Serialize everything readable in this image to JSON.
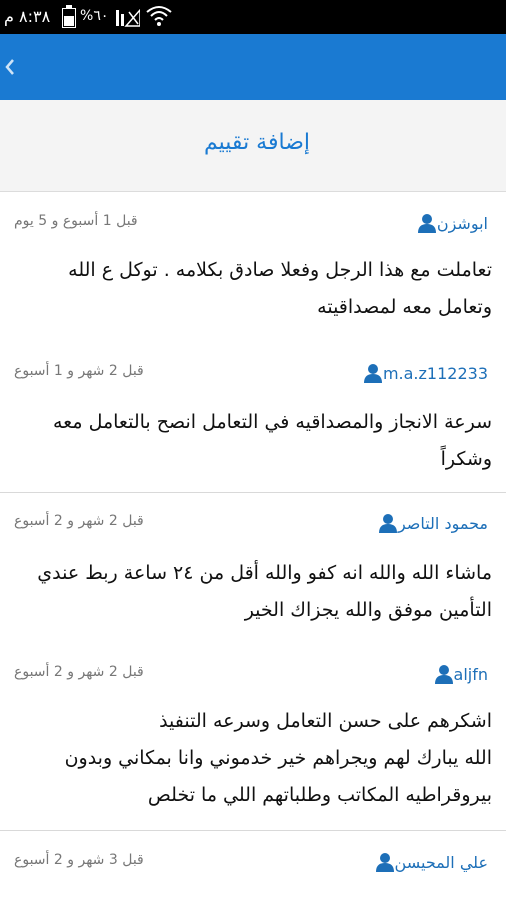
{
  "status_bar": {
    "time": "٨:٣٨ م",
    "battery": "%٦٠"
  },
  "app_bar": {
    "back_icon": "chevron-left-icon",
    "color": "#1a7ad2"
  },
  "header": {
    "add_rating": "إضافة تقييم"
  },
  "reviews": [
    {
      "user": "ابوشزن",
      "time": "قبل 1 أسبوع و 5 يوم",
      "lines": [
        "تعاملت مع هذا الرجل وفعلا صادق بكلامه . توكل ع الله",
        "وتعامل معه لمصداقيته"
      ]
    },
    {
      "user": "m.a.z112233",
      "time": "قبل 2 شهر و 1 أسبوع",
      "lines": [
        "سرعة الانجاز والمصداقيه في التعامل انصح بالتعامل معه",
        "وشكراً"
      ]
    },
    {
      "user": "محمود التاصر",
      "time": "قبل 2 شهر و 2 أسبوع",
      "lines": [
        "ماشاء الله والله انه كفو والله أقل من ٢٤ ساعة ربط عندي",
        "التأمين موفق والله يجزاك الخير"
      ]
    },
    {
      "user": "aljfn",
      "time": "قبل 2 شهر و 2 أسبوع",
      "lines": [
        "اشكرهم على حسن التعامل وسرعه التنفيذ",
        "الله يبارك لهم ويجراهم خير خدموني وانا بمكاني وبدون",
        "بيروقراطيه المكاتب وطلباتهم اللي ما تخلص"
      ]
    },
    {
      "user": "علي المحيسن",
      "time": "قبل 3 شهر و 2 أسبوع",
      "lines": []
    }
  ]
}
